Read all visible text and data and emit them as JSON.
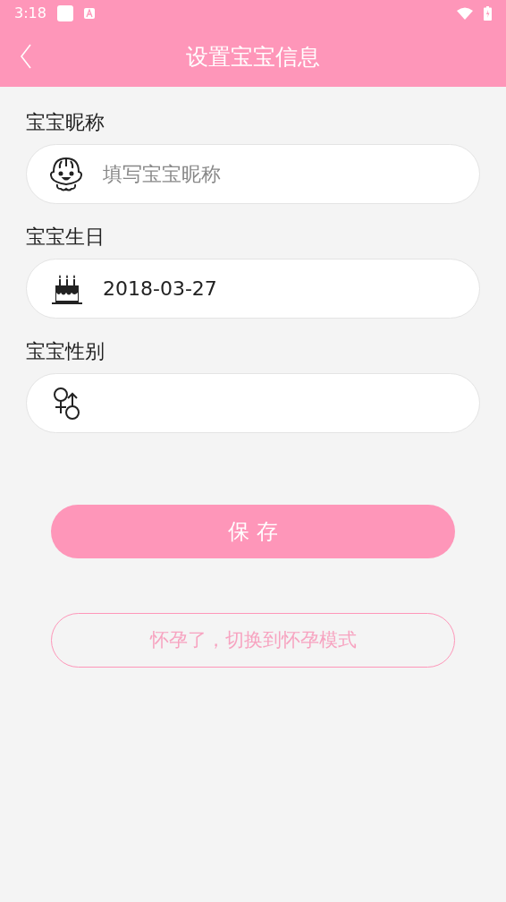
{
  "status_bar": {
    "time": "3:18"
  },
  "header": {
    "title": "设置宝宝信息"
  },
  "fields": [
    {
      "kind": "nickname",
      "label": "宝宝昵称",
      "placeholder": "填写宝宝昵称"
    },
    {
      "kind": "birthday",
      "label": "宝宝生日",
      "value": "2018-03-27"
    },
    {
      "kind": "gender",
      "label": "宝宝性别"
    }
  ],
  "save_button": "保 存",
  "switch_button": "怀孕了，切换到怀孕模式"
}
